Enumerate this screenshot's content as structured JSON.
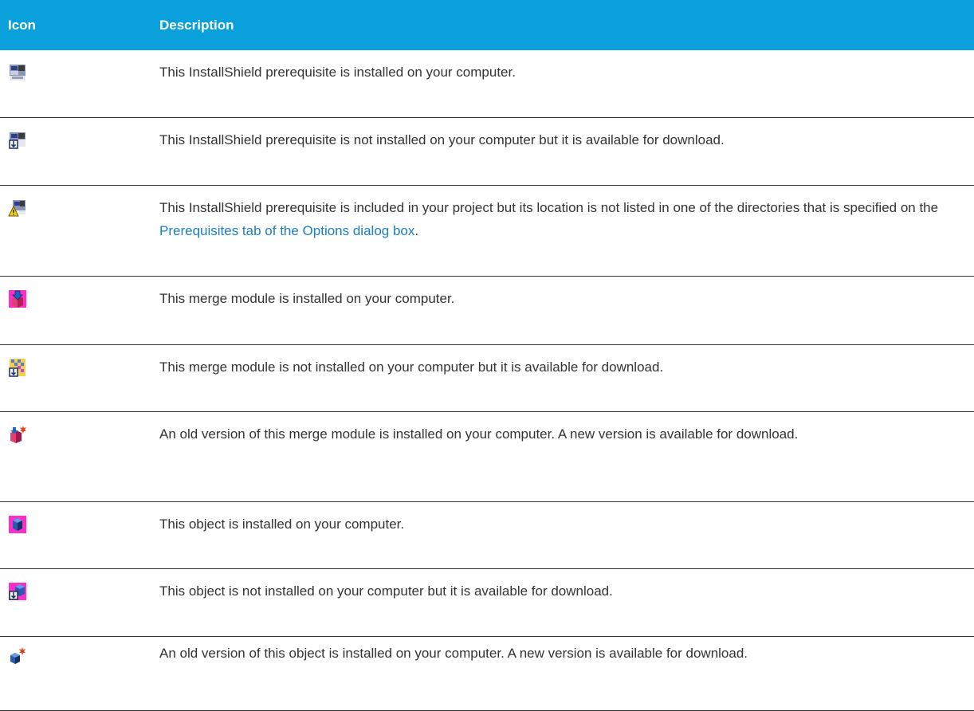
{
  "table": {
    "headers": {
      "icon": "Icon",
      "description": "Description"
    },
    "rows": [
      {
        "icon": "installshield-prerequisite-installed-icon",
        "text": "This InstallShield prerequisite is installed on your computer."
      },
      {
        "icon": "installshield-prerequisite-download-icon",
        "text": "This InstallShield prerequisite is not installed on your computer but it is available for download."
      },
      {
        "icon": "installshield-prerequisite-warning-icon",
        "text_before": "This InstallShield prerequisite is included in your project but its location is not listed in one of the directories that is specified on the ",
        "link": "Prerequisites tab of the Options dialog box",
        "text_after": "."
      },
      {
        "icon": "merge-module-installed-icon",
        "text": "This merge module is installed on your computer."
      },
      {
        "icon": "merge-module-download-icon",
        "text": "This merge module is not installed on your computer but it is available for download."
      },
      {
        "icon": "merge-module-old-version-icon",
        "text": "An old version of this merge module is installed on your computer. A new version is available for download."
      },
      {
        "icon": "object-installed-icon",
        "text": "This object is installed on your computer."
      },
      {
        "icon": "object-download-icon",
        "text": "This object is not installed on your computer but it is available for download."
      },
      {
        "icon": "object-old-version-icon",
        "text": "An old version of this object is installed on your computer. A new version is available for download."
      }
    ]
  },
  "colors": {
    "header_bg": "#0aa0dc",
    "header_text": "#ffffff",
    "link": "#1a7fbf",
    "row_border": "#333333"
  }
}
